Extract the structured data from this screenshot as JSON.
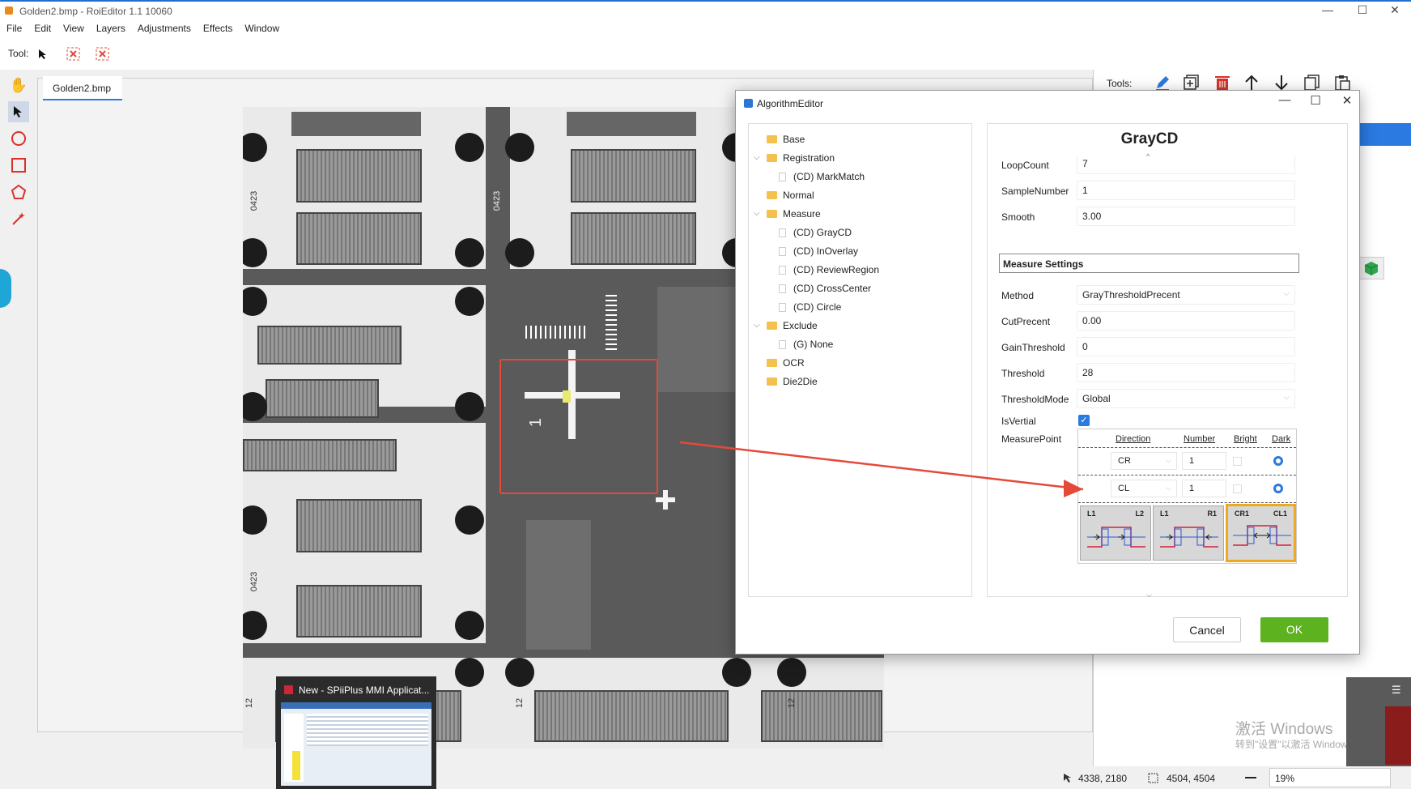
{
  "window": {
    "title": "Golden2.bmp - RoiEditor 1.1 10060",
    "minimize": "—",
    "maximize": "☐",
    "close": "✕"
  },
  "menu": [
    "File",
    "Edit",
    "View",
    "Layers",
    "Adjustments",
    "Effects",
    "Window"
  ],
  "toolbar": {
    "label": "Tool:"
  },
  "doc_tab": "Golden2.bmp",
  "right_tools_label": "Tools:",
  "board_labels": [
    "0423",
    "0423",
    "0423",
    "1",
    "12",
    "12",
    "12"
  ],
  "dialog": {
    "title": "AlgorithmEditor",
    "tree": [
      {
        "label": "Base",
        "type": "folder",
        "level": 0
      },
      {
        "label": "Registration",
        "type": "folder",
        "level": 0,
        "expanded": true
      },
      {
        "label": "(CD) MarkMatch",
        "type": "leaf",
        "level": 1
      },
      {
        "label": "Normal",
        "type": "folder",
        "level": 0
      },
      {
        "label": "Measure",
        "type": "folder",
        "level": 0,
        "expanded": true
      },
      {
        "label": "(CD) GrayCD",
        "type": "leaf",
        "level": 1
      },
      {
        "label": "(CD) InOverlay",
        "type": "leaf",
        "level": 1
      },
      {
        "label": "(CD) ReviewRegion",
        "type": "leaf",
        "level": 1
      },
      {
        "label": "(CD) CrossCenter",
        "type": "leaf",
        "level": 1
      },
      {
        "label": "(CD) Circle",
        "type": "leaf",
        "level": 1
      },
      {
        "label": "Exclude",
        "type": "folder",
        "level": 0,
        "expanded": true
      },
      {
        "label": "(G) None",
        "type": "leaf",
        "level": 1
      },
      {
        "label": "OCR",
        "type": "folder",
        "level": 0
      },
      {
        "label": "Die2Die",
        "type": "folder",
        "level": 0
      }
    ],
    "props_title": "GrayCD",
    "fields_top": [
      {
        "label": "LoopCount",
        "value": "7"
      },
      {
        "label": "SampleNumber",
        "value": "1"
      },
      {
        "label": "Smooth",
        "value": "3.00"
      }
    ],
    "measure_settings": "Measure Settings",
    "fields_measure": [
      {
        "label": "Method",
        "value": "GrayThresholdPrecent",
        "dropdown": true
      },
      {
        "label": "CutPrecent",
        "value": "0.00"
      },
      {
        "label": "GainThreshold",
        "value": "0"
      },
      {
        "label": "Threshold",
        "value": "28"
      },
      {
        "label": "ThresholdMode",
        "value": "Global",
        "dropdown": true
      }
    ],
    "isvertial_label": "IsVertial",
    "isvertial_checked": true,
    "measurepoint_label": "MeasurePoint",
    "mp_headers": {
      "direction": "Direction",
      "number": "Number",
      "bright": "Bright",
      "dark": "Dark"
    },
    "mp_rows": [
      {
        "direction": "CR",
        "number": "1",
        "selected": "Dark"
      },
      {
        "direction": "CL",
        "number": "1",
        "selected": "Dark"
      }
    ],
    "mp_thumbs": [
      {
        "left": "L1",
        "right": "L2"
      },
      {
        "left": "L1",
        "right": "R1"
      },
      {
        "left": "CR1",
        "right": "CL1",
        "selected": true
      }
    ],
    "cancel": "Cancel",
    "ok": "OK"
  },
  "taskbar_thumb": "New - SPiiPlus MMI Applicat...",
  "status": {
    "cursor": "4338, 2180",
    "size": "4504, 4504",
    "zoom": "19%"
  },
  "watermark": {
    "line1": "激活 Windows",
    "line2": "转到\"设置\"以激活 Windows。"
  },
  "colors": {
    "accent": "#2a7ae2",
    "ok": "#5cb21f",
    "roi": "#e5493a",
    "annotation_arrow": "#e5493a"
  }
}
